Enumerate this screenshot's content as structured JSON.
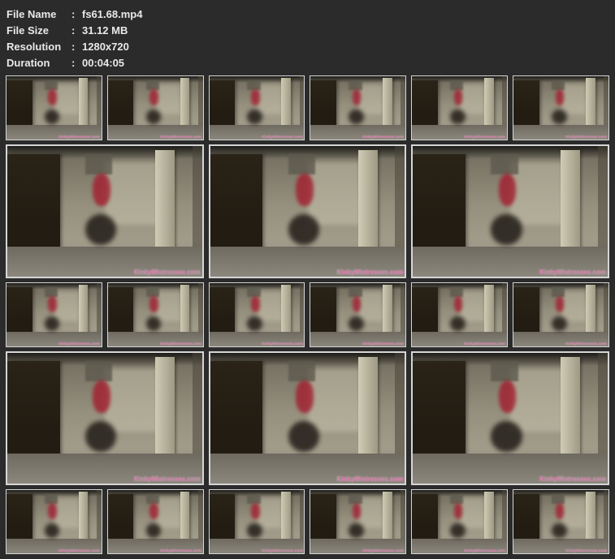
{
  "meta": {
    "rows": [
      {
        "label": "File Name",
        "value": "fs61.68.mp4"
      },
      {
        "label": "File Size",
        "value": "31.12 MB"
      },
      {
        "label": "Resolution",
        "value": "1280x720"
      },
      {
        "label": "Duration",
        "value": "00:04:05"
      }
    ]
  },
  "watermark": "KinkyMistresses.com",
  "grid": {
    "rows": [
      {
        "type": "small",
        "count": 6
      },
      {
        "type": "large",
        "count": 3
      },
      {
        "type": "small",
        "count": 6
      },
      {
        "type": "large",
        "count": 3
      },
      {
        "type": "small",
        "count": 6
      }
    ]
  },
  "colors": {
    "background": "#2b2b2b",
    "header_text": "#e9e9e9",
    "thumb_border": "#d6d6d6",
    "watermark_pink": "#d878a8",
    "accent_red": "#a21d2e"
  }
}
